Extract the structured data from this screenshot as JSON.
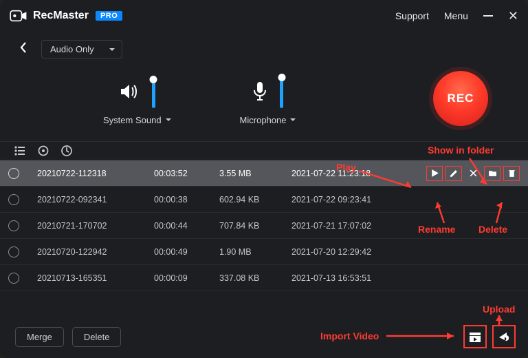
{
  "app": {
    "name": "RecMaster",
    "badge": "PRO",
    "support": "Support",
    "menu": "Menu"
  },
  "mode": {
    "selected": "Audio Only"
  },
  "controls": {
    "system_sound_label": "System Sound",
    "microphone_label": "Microphone",
    "rec_label": "REC"
  },
  "recordings": [
    {
      "name": "20210722-112318",
      "duration": "00:03:52",
      "size": "3.55 MB",
      "date": "2021-07-22 11:23:18",
      "selected": true
    },
    {
      "name": "20210722-092341",
      "duration": "00:00:38",
      "size": "602.94 KB",
      "date": "2021-07-22 09:23:41",
      "selected": false
    },
    {
      "name": "20210721-170702",
      "duration": "00:00:44",
      "size": "707.84 KB",
      "date": "2021-07-21 17:07:02",
      "selected": false
    },
    {
      "name": "20210720-122942",
      "duration": "00:00:49",
      "size": "1.90 MB",
      "date": "2021-07-20 12:29:42",
      "selected": false
    },
    {
      "name": "20210713-165351",
      "duration": "00:00:09",
      "size": "337.08 KB",
      "date": "2021-07-13 16:53:51",
      "selected": false
    }
  ],
  "bottom": {
    "merge": "Merge",
    "delete": "Delete"
  },
  "annotations": {
    "play": "Play",
    "show_in_folder": "Show in folder",
    "rename": "Rename",
    "delete": "Delete",
    "import_video": "Import Video",
    "upload": "Upload"
  }
}
